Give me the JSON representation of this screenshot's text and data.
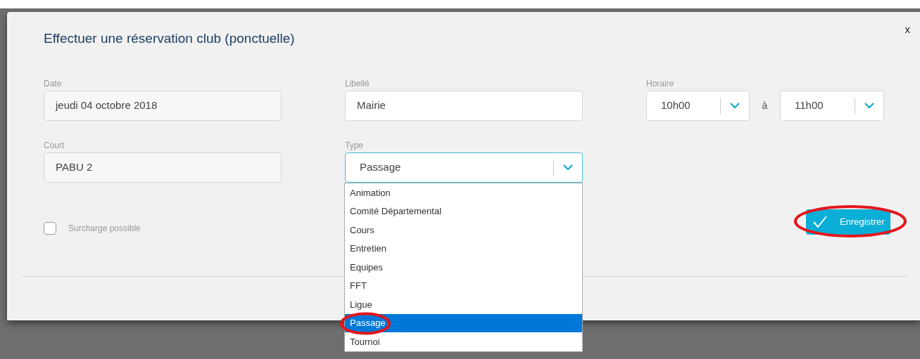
{
  "dialog": {
    "title": "Effectuer une réservation club (ponctuelle)",
    "close": "x"
  },
  "date": {
    "label": "Date",
    "value": "jeudi 04 octobre 2018"
  },
  "libelle": {
    "label": "Libellé",
    "value": "Mairie"
  },
  "horaire": {
    "label": "Horaire",
    "from": "10h00",
    "separator": "à",
    "to": "11h00"
  },
  "court": {
    "label": "Court",
    "value": "PABU 2"
  },
  "type": {
    "label": "Type",
    "value": "Passage",
    "expanded": true,
    "options": [
      {
        "label": "Animation",
        "selected": false
      },
      {
        "label": "Comité Départemental",
        "selected": false
      },
      {
        "label": "Cours",
        "selected": false
      },
      {
        "label": "Entretien",
        "selected": false
      },
      {
        "label": "Equipes",
        "selected": false
      },
      {
        "label": "FFT",
        "selected": false
      },
      {
        "label": "Ligue",
        "selected": false
      },
      {
        "label": "Passage",
        "selected": true
      },
      {
        "label": "Tournoi",
        "selected": false
      }
    ]
  },
  "surcharge": {
    "label": "Surcharge possible",
    "checked": false
  },
  "save_button": {
    "label": "Enregistrer"
  }
}
